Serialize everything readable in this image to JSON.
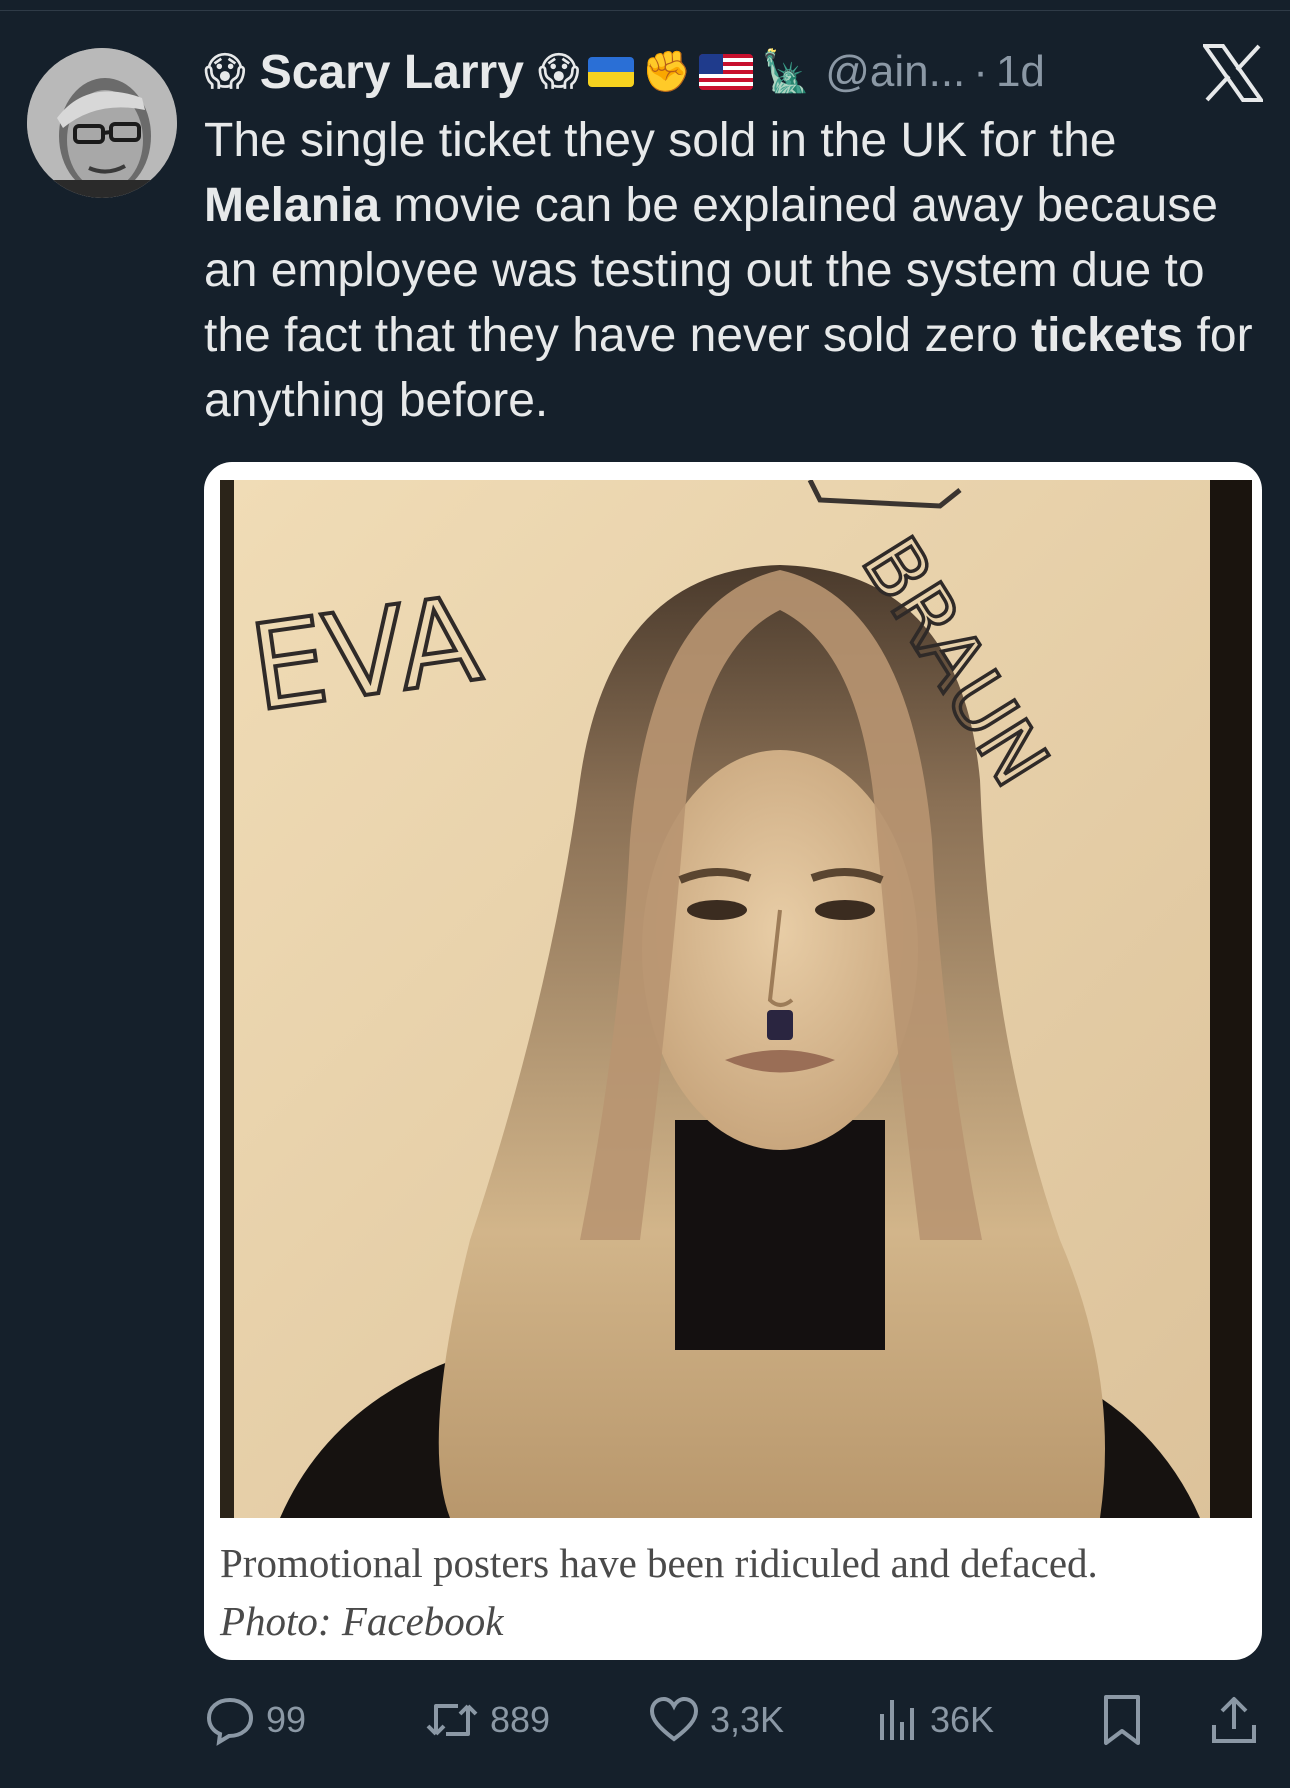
{
  "tweet": {
    "author": {
      "name": "Scary Larry",
      "handle": "@ain...",
      "emoji_before": "😱",
      "emoji_after": "😱",
      "badges": [
        "ukraine-flag-icon",
        "raised-fist-icon",
        "us-flag-icon",
        "statue-of-liberty-icon"
      ],
      "fist_emoji": "✊",
      "liberty_emoji": "🗽"
    },
    "separator": "·",
    "time": "1d",
    "text": {
      "part1": "The single ticket they sold in the UK for the ",
      "bold1": "Melania",
      "part2": " movie can be explained away because an employee was testing out the system due to the fact that they have never sold zero ",
      "bold2": "tickets",
      "part3": " for anything before."
    },
    "card": {
      "image_text_left": "EVA",
      "image_text_right": "BRAUN",
      "caption": "Promotional posters have been ridiculed and defaced.",
      "credit": "Photo: Facebook"
    },
    "actions": {
      "replies": "99",
      "reposts": "889",
      "likes": "3,3K",
      "views": "36K"
    }
  },
  "colors": {
    "background": "#15202b",
    "text": "#e7e9ea",
    "muted": "#8b98a5"
  }
}
